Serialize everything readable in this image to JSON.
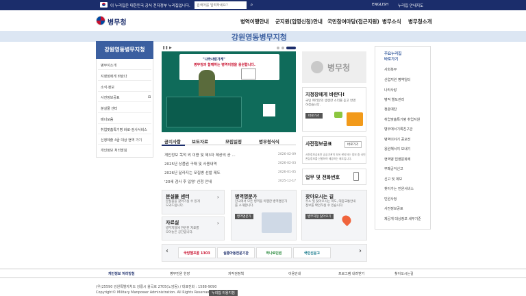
{
  "topbar": {
    "notice": "이 누리집은 대한민국 공식 전자정부 누리집입니다.",
    "search_placeholder": "검색어를 입력하세요?",
    "english": "ENGLISH",
    "sitemap": "누리집 안내지도"
  },
  "header": {
    "logo": "병무청",
    "gnb": [
      "병역이행안내",
      "군지원(입영신청)안내",
      "국민참여마당(접근지원)",
      "병무소식",
      "병무청소개"
    ]
  },
  "hero": {
    "title": "강원영동병무지청"
  },
  "lnb": {
    "title": "강원영동병무지청",
    "items": [
      "병무지소개",
      "지청장에게 바란다",
      "소식·정보",
      "사전정보공표",
      "분실물 센터",
      "배너모음",
      "취업맞춤특기병 바로-검사서비스",
      "신청제출 4급 대상 현역 가기",
      "개인정보 처리방침"
    ]
  },
  "banner": {
    "card_title": "\"나라사랑가게\"",
    "card_body": "병무청과 함께하는 병역이행을 응원합니다."
  },
  "tabs": [
    "공지사항",
    "보도자료",
    "모집일정",
    "병무청식식"
  ],
  "news": [
    {
      "title": "개인정보 목적 외 이용 및 제3자 제공의 공 ...",
      "date": "2026-02-09"
    },
    {
      "title": "2025년 상품권 구매 및 사용내역",
      "date": "2026-02-03"
    },
    {
      "title": "2026년 달라지는 모집병 선발 제도",
      "date": "2026-01-05"
    },
    {
      "title": "'20세 검사 후 입영' 신청 안내",
      "date": "2025-12-17"
    }
  ],
  "tiles": {
    "lost": {
      "title": "분실물 센터",
      "desc1": "분실물을 찾아가실 수 있게",
      "desc2": "도와드립니다."
    },
    "data": {
      "title": "자료실",
      "desc1": "병무지청에 관련된 자료를",
      "desc2": "모아놓은 공간입니다."
    },
    "merit": {
      "title": "병역명문가",
      "desc1": "한국에서 모든 병역을 이행한 병역명문가",
      "desc2": "를 소개합니다.",
      "btn": "병역명문가"
    },
    "directions": {
      "title": "찾아오시는 길",
      "desc1": "주소 및 찾아오시는 약도, 대중교통안내",
      "desc2": "정보를 확인하실 수 있습니다.",
      "btn": "병무지청 찾아오기"
    }
  },
  "side": {
    "mma": "병무청",
    "chief_title": "지청장에게 바란다!",
    "chief_desc1": "국민 여러분의 생생한 소리를 듣고 반영",
    "chief_desc2": "하겠습니다.",
    "chief_btn": "바로가기",
    "disclosure_title": "사전정보공표",
    "disclosure_btn": "바로가기",
    "disclosure_desc1": "사전정보공표란 공공기관이 보유 관리하는 정보 중 국민",
    "disclosure_desc2": "관심정보를 선별하여 제공하는 제도입니다.",
    "contact_title": "업무 및 전화번호"
  },
  "right": {
    "head1": "주요누리집",
    "head2": "바로가기",
    "items": [
      "사회복무",
      "산업지원 병역일터",
      "나라사랑",
      "병적 별도관리",
      "청춘예찬",
      "취업맞춤특기병 취업지원",
      "병무에서기록친구관",
      "병역이야기 공모전",
      "용원해서지 보내기",
      "현역병 입영문화제",
      "부패공익신고",
      "신고 및 제보",
      "찾아가는 민원서비스",
      "민원사정",
      "사전정보공표",
      "제공개 대상정보 세부기준"
    ]
  },
  "partners": [
    "국방헬프콜 1303",
    "실종아동전문기관",
    "하나로민원",
    "국민신문고"
  ],
  "footer": {
    "nav": [
      "개인정보 처리방침",
      "병무민원 헌장",
      "저작권정책",
      "이용안내",
      "프로그램 내려받기",
      "찾아오시는길"
    ],
    "addr": "(우)25590 강원특별자치도 강릉시 율곡로 2705(노암동) / 대표전화 : 1588-9090",
    "copyright": "Copyright© Military Manpower Administration. All Rights Reserved.",
    "btn": "누리집 이용지침"
  }
}
